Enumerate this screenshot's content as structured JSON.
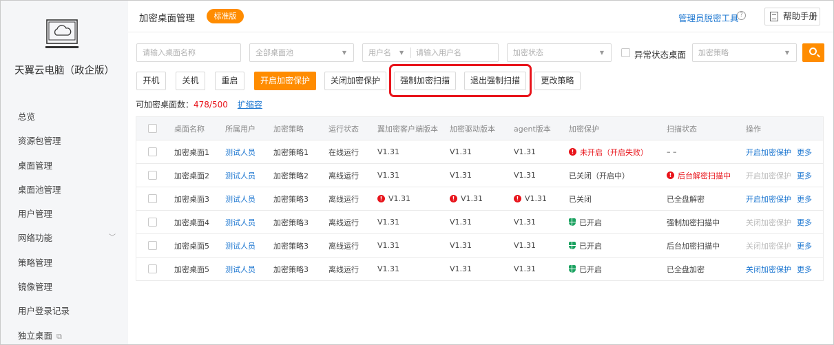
{
  "sidebar": {
    "brand": "天翼云电脑（政企版）",
    "items": [
      {
        "label": "总览"
      },
      {
        "label": "资源包管理"
      },
      {
        "label": "桌面管理"
      },
      {
        "label": "桌面池管理"
      },
      {
        "label": "用户管理"
      },
      {
        "label": "网络功能",
        "chevron": "chevron-down-icon"
      },
      {
        "label": "策略管理"
      },
      {
        "label": "镜像管理"
      },
      {
        "label": "用户登录记录"
      },
      {
        "label": "独立桌面",
        "icon": "external-link-icon"
      }
    ]
  },
  "header": {
    "title": "加密桌面管理",
    "edition_badge": "标准版",
    "admin_tool": "管理员脱密工具",
    "help_label": "帮助手册"
  },
  "filters": {
    "desktop_name_placeholder": "请输入桌面名称",
    "pool_select": "全部桌面池",
    "user_field_select": "用户名",
    "username_placeholder": "请输入用户名",
    "encryption_status_select": "加密状态",
    "abnormal_label": "异常状态桌面",
    "policy_select": "加密策略"
  },
  "actions": {
    "power_on": "开机",
    "power_off": "关机",
    "restart": "重启",
    "enable_protection": "开启加密保护",
    "disable_protection": "关闭加密保护",
    "force_scan": "强制加密扫描",
    "exit_force_scan": "退出强制扫描",
    "change_policy": "更改策略"
  },
  "quota": {
    "label": "可加密桌面数：",
    "value": "478/500",
    "expand": "扩缩容"
  },
  "table": {
    "columns": [
      "桌面名称",
      "所属用户",
      "加密策略",
      "运行状态",
      "翼加密客户端版本",
      "加密驱动版本",
      "agent版本",
      "加密保护",
      "扫描状态",
      "操作"
    ],
    "rows": [
      {
        "name": "加密桌面1",
        "user": "测试人员",
        "policy": "加密策略1",
        "run_status": "在线运行",
        "client_ver": "V1.31",
        "client_alert": false,
        "driver_ver": "V1.31",
        "driver_alert": false,
        "agent_ver": "V1.31",
        "agent_alert": false,
        "protection": "未开启（开启失败）",
        "protection_state": "error",
        "scan_status": "– –",
        "scan_state": "normal",
        "op_primary": "开启加密保护",
        "op_primary_enabled": true,
        "op_more": "更多"
      },
      {
        "name": "加密桌面2",
        "user": "测试人员",
        "policy": "加密策略2",
        "run_status": "离线运行",
        "client_ver": "V1.31",
        "client_alert": false,
        "driver_ver": "V1.31",
        "driver_alert": false,
        "agent_ver": "V1.31",
        "agent_alert": false,
        "protection": "已关闭（开启中）",
        "protection_state": "normal",
        "scan_status": "后台解密扫描中",
        "scan_state": "error",
        "op_primary": "开启加密保护",
        "op_primary_enabled": false,
        "op_more": "更多"
      },
      {
        "name": "加密桌面3",
        "user": "测试人员",
        "policy": "加密策略3",
        "run_status": "离线运行",
        "client_ver": "V1.31",
        "client_alert": true,
        "driver_ver": "V1.31",
        "driver_alert": true,
        "agent_ver": "V1.31",
        "agent_alert": true,
        "protection": "已关闭",
        "protection_state": "normal",
        "scan_status": "已全盘解密",
        "scan_state": "normal",
        "op_primary": "开启加密保护",
        "op_primary_enabled": true,
        "op_more": "更多"
      },
      {
        "name": "加密桌面4",
        "user": "测试人员",
        "policy": "加密策略3",
        "run_status": "离线运行",
        "client_ver": "V1.31",
        "client_alert": false,
        "driver_ver": "V1.31",
        "driver_alert": false,
        "agent_ver": "V1.31",
        "agent_alert": false,
        "protection": "已开启",
        "protection_state": "on",
        "scan_status": "强制加密扫描中",
        "scan_state": "normal",
        "op_primary": "关闭加密保护",
        "op_primary_enabled": false,
        "op_more": "更多"
      },
      {
        "name": "加密桌面5",
        "user": "测试人员",
        "policy": "加密策略3",
        "run_status": "离线运行",
        "client_ver": "V1.31",
        "client_alert": false,
        "driver_ver": "V1.31",
        "driver_alert": false,
        "agent_ver": "V1.31",
        "agent_alert": false,
        "protection": "已开启",
        "protection_state": "on",
        "scan_status": "后台加密扫描中",
        "scan_state": "normal",
        "op_primary": "关闭加密保护",
        "op_primary_enabled": false,
        "op_more": "更多"
      },
      {
        "name": "加密桌面5",
        "user": "测试人员",
        "policy": "加密策略3",
        "run_status": "离线运行",
        "client_ver": "V1.31",
        "client_alert": false,
        "driver_ver": "V1.31",
        "driver_alert": false,
        "agent_ver": "V1.31",
        "agent_alert": false,
        "protection": "已开启",
        "protection_state": "on",
        "scan_status": "已全盘加密",
        "scan_state": "normal",
        "op_primary": "关闭加密保护",
        "op_primary_enabled": true,
        "op_more": "更多"
      }
    ]
  },
  "colors": {
    "accent": "#ff8c00",
    "link": "#1f78d1",
    "error": "#e8141b",
    "success": "#19a15f",
    "highlight_box": "#e8141b"
  }
}
